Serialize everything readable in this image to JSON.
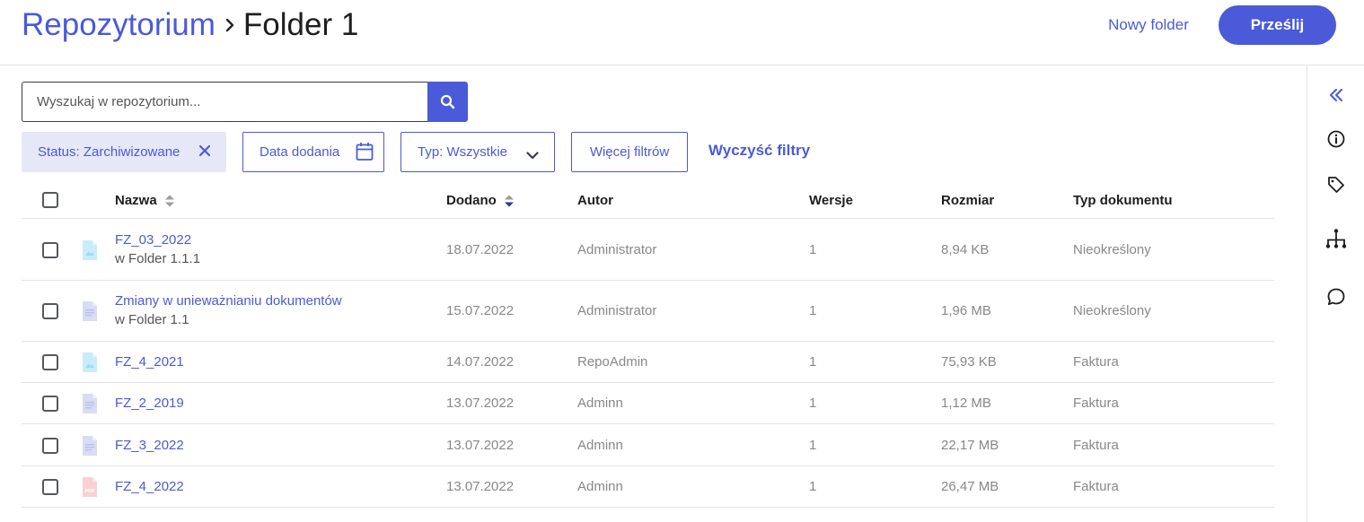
{
  "header": {
    "breadcrumb_root": "Repozytorium",
    "breadcrumb_current": "Folder 1",
    "new_folder_label": "Nowy folder",
    "upload_label": "Prześlij"
  },
  "search": {
    "placeholder": "Wyszukaj w repozytorium...",
    "value": ""
  },
  "filters": {
    "status_chip": "Status: Zarchiwizowane",
    "date_added": "Data dodania",
    "type_select": "Typ: Wszystkie",
    "more_filters": "Więcej filtrów",
    "clear_filters": "Wyczyść filtry"
  },
  "table": {
    "columns": {
      "name": "Nazwa",
      "added": "Dodano",
      "author": "Autor",
      "versions": "Wersje",
      "size": "Rozmiar",
      "doc_type": "Typ dokumentu"
    },
    "rows": [
      {
        "name": "FZ_03_2022",
        "location": "w Folder 1.1.1",
        "added": "18.07.2022",
        "author": "Administrator",
        "versions": "1",
        "size": "8,94 KB",
        "doc_type": "Nieokreślony",
        "icon": "image-file-icon"
      },
      {
        "name": "Zmiany w unieważnianiu dokumentów",
        "location": "w Folder 1.1",
        "added": "15.07.2022",
        "author": "Administrator",
        "versions": "1",
        "size": "1,96 MB",
        "doc_type": "Nieokreślony",
        "icon": "document-file-icon"
      },
      {
        "name": "FZ_4_2021",
        "location": "",
        "added": "14.07.2022",
        "author": "RepoAdmin",
        "versions": "1",
        "size": "75,93 KB",
        "doc_type": "Faktura",
        "icon": "image-file-icon"
      },
      {
        "name": "FZ_2_2019",
        "location": "",
        "added": "13.07.2022",
        "author": "Adminn",
        "versions": "1",
        "size": "1,12 MB",
        "doc_type": "Faktura",
        "icon": "document-file-icon"
      },
      {
        "name": "FZ_3_2022",
        "location": "",
        "added": "13.07.2022",
        "author": "Adminn",
        "versions": "1",
        "size": "22,17 MB",
        "doc_type": "Faktura",
        "icon": "document-file-icon"
      },
      {
        "name": "FZ_4_2022",
        "location": "",
        "added": "13.07.2022",
        "author": "Adminn",
        "versions": "1",
        "size": "26,47 MB",
        "doc_type": "Faktura",
        "icon": "pdf-file-icon"
      }
    ]
  },
  "sidebar_icons": [
    "collapse-icon",
    "info-icon",
    "tag-icon",
    "hierarchy-icon",
    "comment-icon"
  ],
  "colors": {
    "accent": "#4a5ad8",
    "chip_bg": "#e6e8f8",
    "divider": "#e3e4e8",
    "muted_text": "#888888"
  }
}
